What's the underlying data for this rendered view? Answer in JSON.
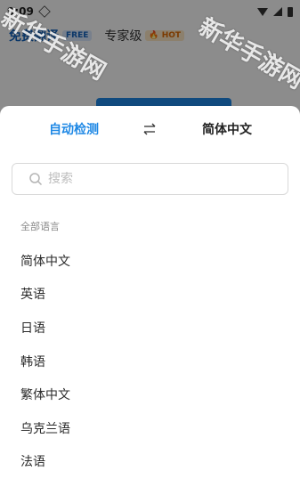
{
  "status_bar": {
    "time": "9:09"
  },
  "mode_tabs": [
    {
      "label": "免费翻译",
      "badge": "FREE"
    },
    {
      "label": "专家级",
      "badge": "HOT",
      "badge_icon": "fire-icon"
    }
  ],
  "language_picker": {
    "source_lang": "自动检测",
    "target_lang": "简体中文",
    "swap_icon": "swap-arrows-icon",
    "search": {
      "placeholder": "搜索",
      "value": ""
    },
    "section_title": "全部语言",
    "languages": [
      "简体中文",
      "英语",
      "日语",
      "韩语",
      "繁体中文",
      "乌克兰语",
      "法语"
    ]
  },
  "watermark": "新华手游网",
  "colors": {
    "accent": "#1e88e5",
    "overlay": "rgba(0,0,0,0.45)"
  }
}
